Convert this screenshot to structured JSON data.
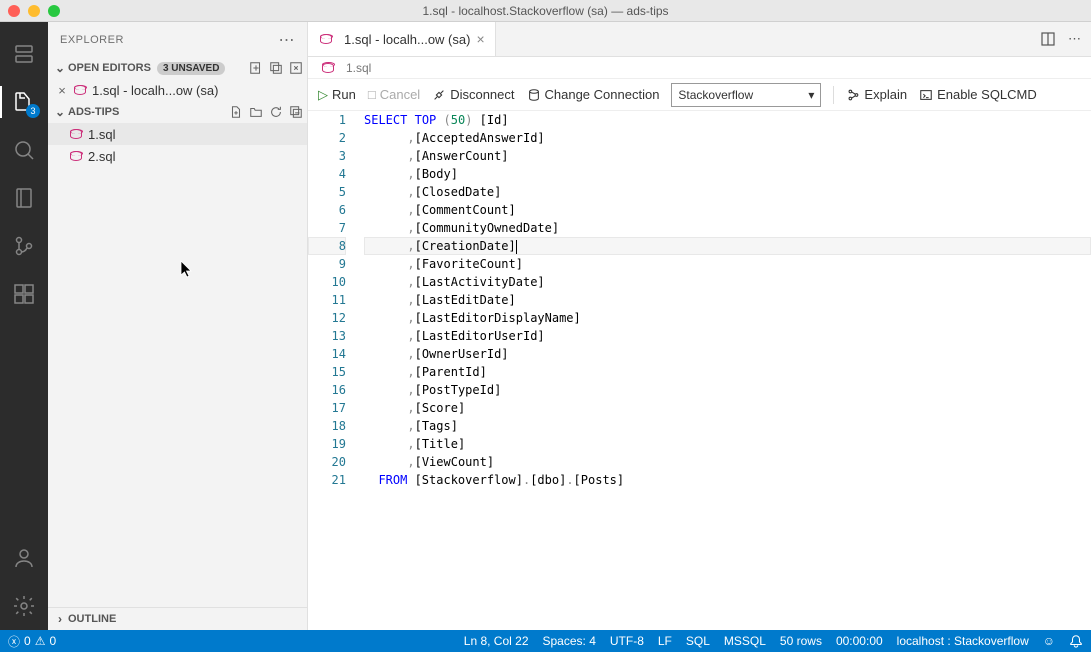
{
  "window": {
    "title": "1.sql - localhost.Stackoverflow (sa) — ads-tips"
  },
  "activitybar": {
    "explorer_badge": "3"
  },
  "sidebar": {
    "title": "EXPLORER",
    "openEditors": {
      "label": "OPEN EDITORS",
      "unsaved_badge": "3 UNSAVED",
      "items": [
        {
          "label": "1.sql - localh...ow (sa)"
        }
      ]
    },
    "folder": {
      "label": "ADS-TIPS",
      "files": [
        {
          "label": "1.sql"
        },
        {
          "label": "2.sql"
        }
      ]
    },
    "outline": {
      "label": "OUTLINE"
    }
  },
  "tabs": {
    "items": [
      {
        "label": "1.sql - localh...ow (sa)"
      }
    ]
  },
  "breadcrumb": {
    "items": [
      "1.sql"
    ]
  },
  "toolbar": {
    "run": "Run",
    "cancel": "Cancel",
    "disconnect": "Disconnect",
    "changeConn": "Change Connection",
    "connection": "Stackoverflow",
    "explain": "Explain",
    "sqlcmd": "Enable SQLCMD"
  },
  "code": {
    "lines": [
      {
        "n": 1,
        "indent": 0,
        "type": "select",
        "kw1": "SELECT",
        "kw2": "TOP",
        "paren_open": "(",
        "num": "50",
        "paren_close": ")",
        "col": "[Id]"
      },
      {
        "n": 2,
        "indent": 6,
        "type": "col",
        "col": "[AcceptedAnswerId]"
      },
      {
        "n": 3,
        "indent": 6,
        "type": "col",
        "col": "[AnswerCount]"
      },
      {
        "n": 4,
        "indent": 6,
        "type": "col",
        "col": "[Body]"
      },
      {
        "n": 5,
        "indent": 6,
        "type": "col",
        "col": "[ClosedDate]"
      },
      {
        "n": 6,
        "indent": 6,
        "type": "col",
        "col": "[CommentCount]"
      },
      {
        "n": 7,
        "indent": 6,
        "type": "col",
        "col": "[CommunityOwnedDate]"
      },
      {
        "n": 8,
        "indent": 6,
        "type": "col",
        "col": "[CreationDate]",
        "current": true
      },
      {
        "n": 9,
        "indent": 6,
        "type": "col",
        "col": "[FavoriteCount]"
      },
      {
        "n": 10,
        "indent": 6,
        "type": "col",
        "col": "[LastActivityDate]"
      },
      {
        "n": 11,
        "indent": 6,
        "type": "col",
        "col": "[LastEditDate]"
      },
      {
        "n": 12,
        "indent": 6,
        "type": "col",
        "col": "[LastEditorDisplayName]"
      },
      {
        "n": 13,
        "indent": 6,
        "type": "col",
        "col": "[LastEditorUserId]"
      },
      {
        "n": 14,
        "indent": 6,
        "type": "col",
        "col": "[OwnerUserId]"
      },
      {
        "n": 15,
        "indent": 6,
        "type": "col",
        "col": "[ParentId]"
      },
      {
        "n": 16,
        "indent": 6,
        "type": "col",
        "col": "[PostTypeId]"
      },
      {
        "n": 17,
        "indent": 6,
        "type": "col",
        "col": "[Score]"
      },
      {
        "n": 18,
        "indent": 6,
        "type": "col",
        "col": "[Tags]"
      },
      {
        "n": 19,
        "indent": 6,
        "type": "col",
        "col": "[Title]"
      },
      {
        "n": 20,
        "indent": 6,
        "type": "col",
        "col": "[ViewCount]"
      },
      {
        "n": 21,
        "indent": 2,
        "type": "from",
        "kw": "FROM",
        "ids": [
          "[Stackoverflow]",
          "[dbo]",
          "[Posts]"
        ]
      }
    ]
  },
  "status": {
    "errors": "0",
    "warnings": "0",
    "position": "Ln 8, Col 22",
    "spaces": "Spaces: 4",
    "encoding": "UTF-8",
    "eol": "LF",
    "lang": "SQL",
    "provider": "MSSQL",
    "rows": "50 rows",
    "time": "00:00:00",
    "server": "localhost : Stackoverflow"
  }
}
